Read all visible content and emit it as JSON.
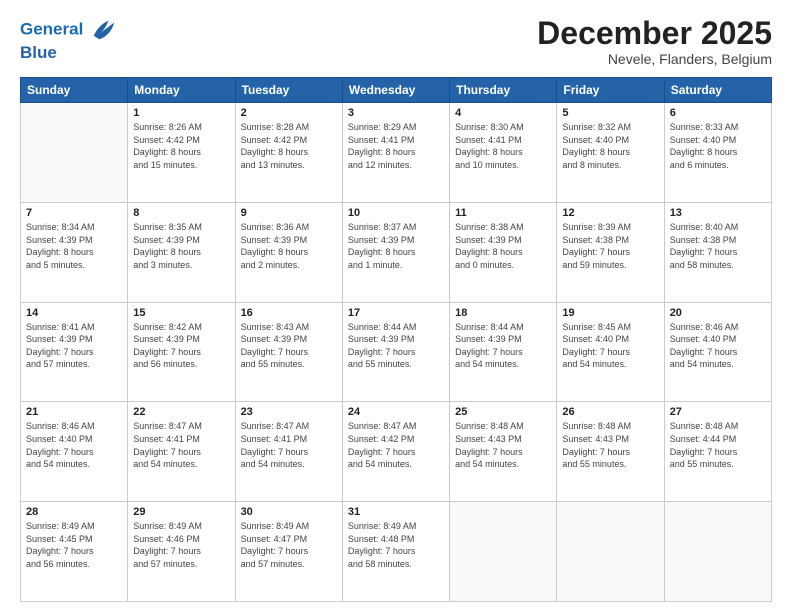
{
  "logo": {
    "line1": "General",
    "line2": "Blue"
  },
  "title": "December 2025",
  "subtitle": "Nevele, Flanders, Belgium",
  "weekdays": [
    "Sunday",
    "Monday",
    "Tuesday",
    "Wednesday",
    "Thursday",
    "Friday",
    "Saturday"
  ],
  "weeks": [
    [
      {
        "day": "",
        "info": ""
      },
      {
        "day": "1",
        "info": "Sunrise: 8:26 AM\nSunset: 4:42 PM\nDaylight: 8 hours\nand 15 minutes."
      },
      {
        "day": "2",
        "info": "Sunrise: 8:28 AM\nSunset: 4:42 PM\nDaylight: 8 hours\nand 13 minutes."
      },
      {
        "day": "3",
        "info": "Sunrise: 8:29 AM\nSunset: 4:41 PM\nDaylight: 8 hours\nand 12 minutes."
      },
      {
        "day": "4",
        "info": "Sunrise: 8:30 AM\nSunset: 4:41 PM\nDaylight: 8 hours\nand 10 minutes."
      },
      {
        "day": "5",
        "info": "Sunrise: 8:32 AM\nSunset: 4:40 PM\nDaylight: 8 hours\nand 8 minutes."
      },
      {
        "day": "6",
        "info": "Sunrise: 8:33 AM\nSunset: 4:40 PM\nDaylight: 8 hours\nand 6 minutes."
      }
    ],
    [
      {
        "day": "7",
        "info": "Sunrise: 8:34 AM\nSunset: 4:39 PM\nDaylight: 8 hours\nand 5 minutes."
      },
      {
        "day": "8",
        "info": "Sunrise: 8:35 AM\nSunset: 4:39 PM\nDaylight: 8 hours\nand 3 minutes."
      },
      {
        "day": "9",
        "info": "Sunrise: 8:36 AM\nSunset: 4:39 PM\nDaylight: 8 hours\nand 2 minutes."
      },
      {
        "day": "10",
        "info": "Sunrise: 8:37 AM\nSunset: 4:39 PM\nDaylight: 8 hours\nand 1 minute."
      },
      {
        "day": "11",
        "info": "Sunrise: 8:38 AM\nSunset: 4:39 PM\nDaylight: 8 hours\nand 0 minutes."
      },
      {
        "day": "12",
        "info": "Sunrise: 8:39 AM\nSunset: 4:38 PM\nDaylight: 7 hours\nand 59 minutes."
      },
      {
        "day": "13",
        "info": "Sunrise: 8:40 AM\nSunset: 4:38 PM\nDaylight: 7 hours\nand 58 minutes."
      }
    ],
    [
      {
        "day": "14",
        "info": "Sunrise: 8:41 AM\nSunset: 4:39 PM\nDaylight: 7 hours\nand 57 minutes."
      },
      {
        "day": "15",
        "info": "Sunrise: 8:42 AM\nSunset: 4:39 PM\nDaylight: 7 hours\nand 56 minutes."
      },
      {
        "day": "16",
        "info": "Sunrise: 8:43 AM\nSunset: 4:39 PM\nDaylight: 7 hours\nand 55 minutes."
      },
      {
        "day": "17",
        "info": "Sunrise: 8:44 AM\nSunset: 4:39 PM\nDaylight: 7 hours\nand 55 minutes."
      },
      {
        "day": "18",
        "info": "Sunrise: 8:44 AM\nSunset: 4:39 PM\nDaylight: 7 hours\nand 54 minutes."
      },
      {
        "day": "19",
        "info": "Sunrise: 8:45 AM\nSunset: 4:40 PM\nDaylight: 7 hours\nand 54 minutes."
      },
      {
        "day": "20",
        "info": "Sunrise: 8:46 AM\nSunset: 4:40 PM\nDaylight: 7 hours\nand 54 minutes."
      }
    ],
    [
      {
        "day": "21",
        "info": "Sunrise: 8:46 AM\nSunset: 4:40 PM\nDaylight: 7 hours\nand 54 minutes."
      },
      {
        "day": "22",
        "info": "Sunrise: 8:47 AM\nSunset: 4:41 PM\nDaylight: 7 hours\nand 54 minutes."
      },
      {
        "day": "23",
        "info": "Sunrise: 8:47 AM\nSunset: 4:41 PM\nDaylight: 7 hours\nand 54 minutes."
      },
      {
        "day": "24",
        "info": "Sunrise: 8:47 AM\nSunset: 4:42 PM\nDaylight: 7 hours\nand 54 minutes."
      },
      {
        "day": "25",
        "info": "Sunrise: 8:48 AM\nSunset: 4:43 PM\nDaylight: 7 hours\nand 54 minutes."
      },
      {
        "day": "26",
        "info": "Sunrise: 8:48 AM\nSunset: 4:43 PM\nDaylight: 7 hours\nand 55 minutes."
      },
      {
        "day": "27",
        "info": "Sunrise: 8:48 AM\nSunset: 4:44 PM\nDaylight: 7 hours\nand 55 minutes."
      }
    ],
    [
      {
        "day": "28",
        "info": "Sunrise: 8:49 AM\nSunset: 4:45 PM\nDaylight: 7 hours\nand 56 minutes."
      },
      {
        "day": "29",
        "info": "Sunrise: 8:49 AM\nSunset: 4:46 PM\nDaylight: 7 hours\nand 57 minutes."
      },
      {
        "day": "30",
        "info": "Sunrise: 8:49 AM\nSunset: 4:47 PM\nDaylight: 7 hours\nand 57 minutes."
      },
      {
        "day": "31",
        "info": "Sunrise: 8:49 AM\nSunset: 4:48 PM\nDaylight: 7 hours\nand 58 minutes."
      },
      {
        "day": "",
        "info": ""
      },
      {
        "day": "",
        "info": ""
      },
      {
        "day": "",
        "info": ""
      }
    ]
  ]
}
